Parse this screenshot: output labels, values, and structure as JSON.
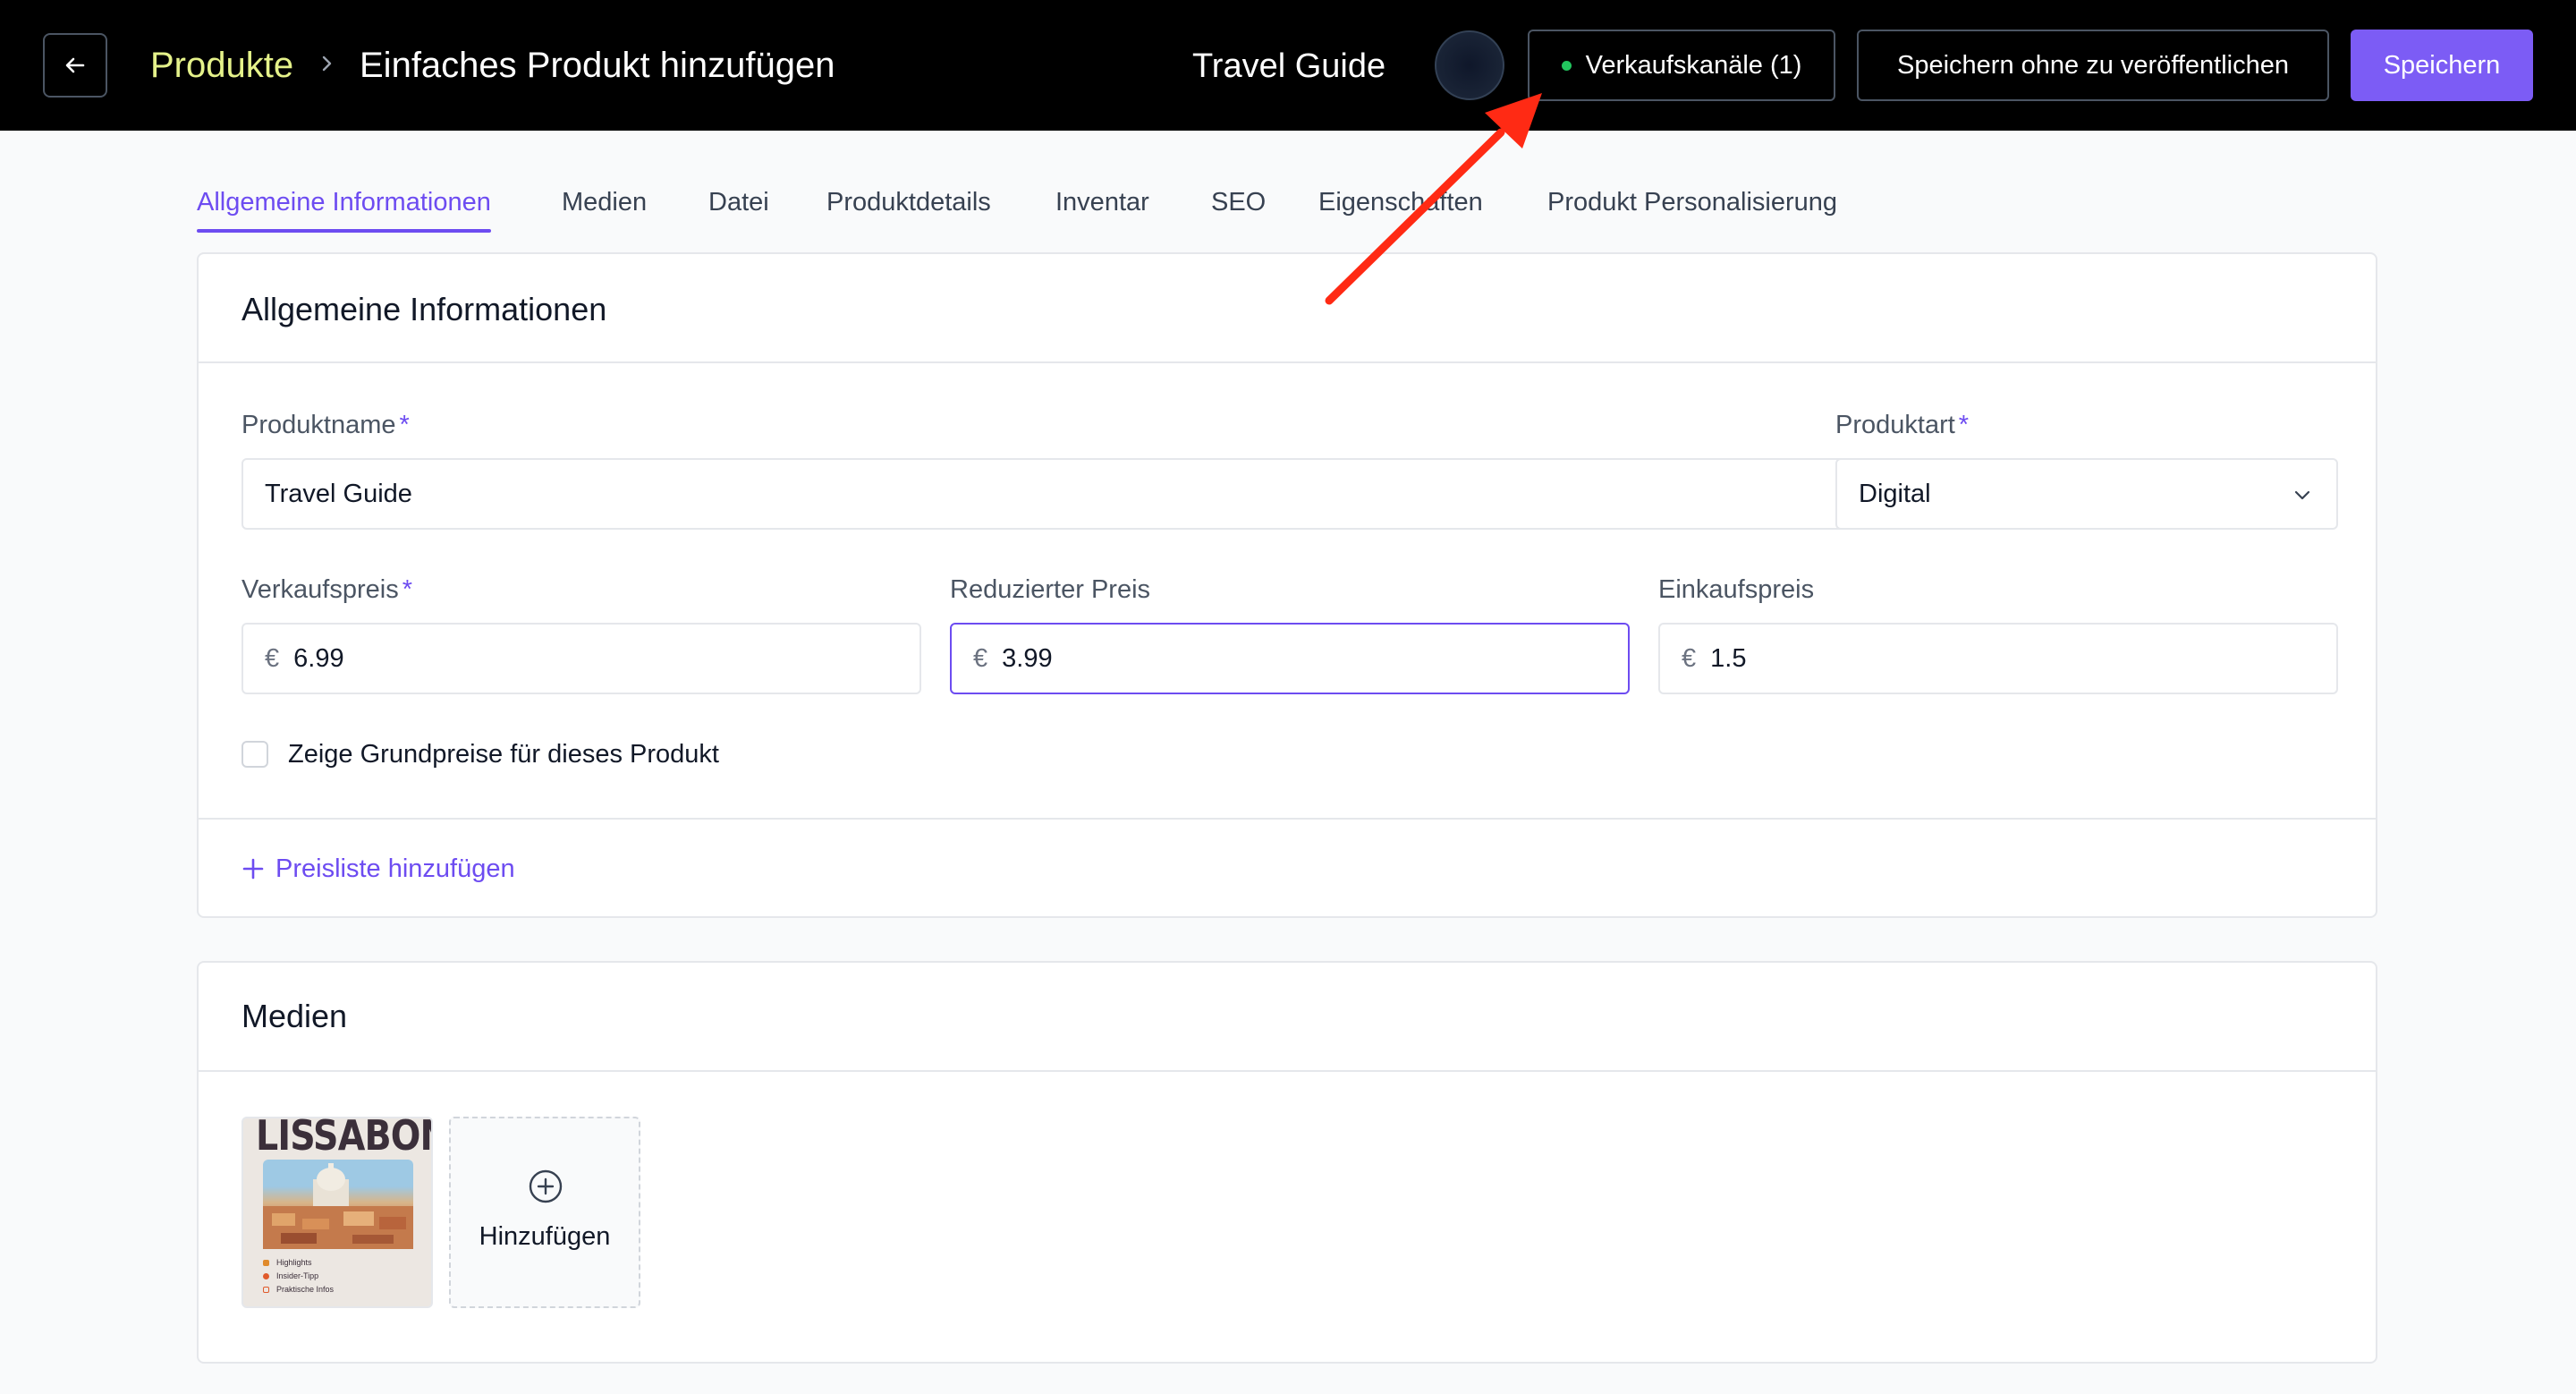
{
  "header": {
    "breadcrumb_root": "Produkte",
    "breadcrumb_page": "Einfaches Produkt hinzufügen",
    "product_name": "Travel Guide",
    "sales_channels_label": "Verkaufskanäle (1)",
    "save_draft_label": "Speichern ohne zu veröffentlichen",
    "save_label": "Speichern"
  },
  "tabs": [
    {
      "label": "Allgemeine Informationen",
      "active": true
    },
    {
      "label": "Medien"
    },
    {
      "label": "Datei"
    },
    {
      "label": "Produktdetails"
    },
    {
      "label": "Inventar"
    },
    {
      "label": "SEO"
    },
    {
      "label": "Eigenschaften"
    },
    {
      "label": "Produkt Personalisierung"
    }
  ],
  "general": {
    "title": "Allgemeine Informationen",
    "product_name_label": "Produktname",
    "product_name_value": "Travel Guide",
    "product_type_label": "Produktart",
    "product_type_value": "Digital",
    "sale_price_label": "Verkaufspreis",
    "sale_price_value": "6.99",
    "reduced_price_label": "Reduzierter Preis",
    "reduced_price_value": "3.99",
    "purchase_price_label": "Einkaufspreis",
    "purchase_price_value": "1.5",
    "currency": "€",
    "required_mark": "*",
    "base_price_checkbox_label": "Zeige Grundpreise für dieses Produkt",
    "add_pricelist_label": "Preisliste hinzufügen"
  },
  "media": {
    "title": "Medien",
    "thumbnail": {
      "title": "LISSABON",
      "bullets": [
        "Highlights",
        "Insider-Tipp",
        "Praktische Infos"
      ]
    },
    "add_label": "Hinzufügen"
  },
  "colors": {
    "accent": "#6d4cf1",
    "breadcrumb": "#e5f28a",
    "status_dot": "#22c55e",
    "annotation_arrow": "#ff2a14"
  }
}
